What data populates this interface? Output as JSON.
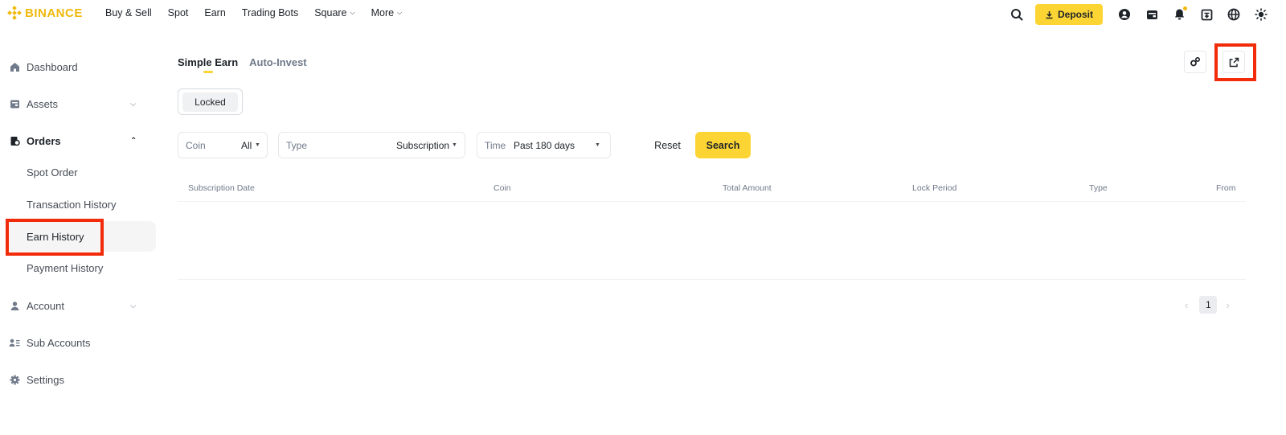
{
  "brand": {
    "name": "BINANCE",
    "color": "#f0b90b"
  },
  "nav": {
    "links": [
      "Buy & Sell",
      "Spot",
      "Earn",
      "Trading Bots",
      "Square",
      "More"
    ],
    "deposit_label": "Deposit"
  },
  "sidebar": {
    "dashboard": "Dashboard",
    "assets": "Assets",
    "orders": "Orders",
    "orders_sub": [
      "Spot Order",
      "Transaction History",
      "Earn History",
      "Payment History"
    ],
    "account": "Account",
    "sub_accounts": "Sub Accounts",
    "settings": "Settings"
  },
  "tabs": [
    "Simple Earn",
    "Auto-Invest"
  ],
  "product_filter": "Locked",
  "filters": {
    "coin_label": "Coin",
    "coin_value": "All",
    "type_label": "Type",
    "type_value": "Subscription",
    "time_label": "Time",
    "time_value": "Past 180 days"
  },
  "actions": {
    "reset": "Reset",
    "search": "Search"
  },
  "table": {
    "columns": [
      "Subscription Date",
      "Coin",
      "Total Amount",
      "Lock Period",
      "Type",
      "From"
    ]
  },
  "pagination": {
    "current_page": "1"
  },
  "colors": {
    "accent": "#fcd535",
    "highlight": "#f22b0a"
  }
}
